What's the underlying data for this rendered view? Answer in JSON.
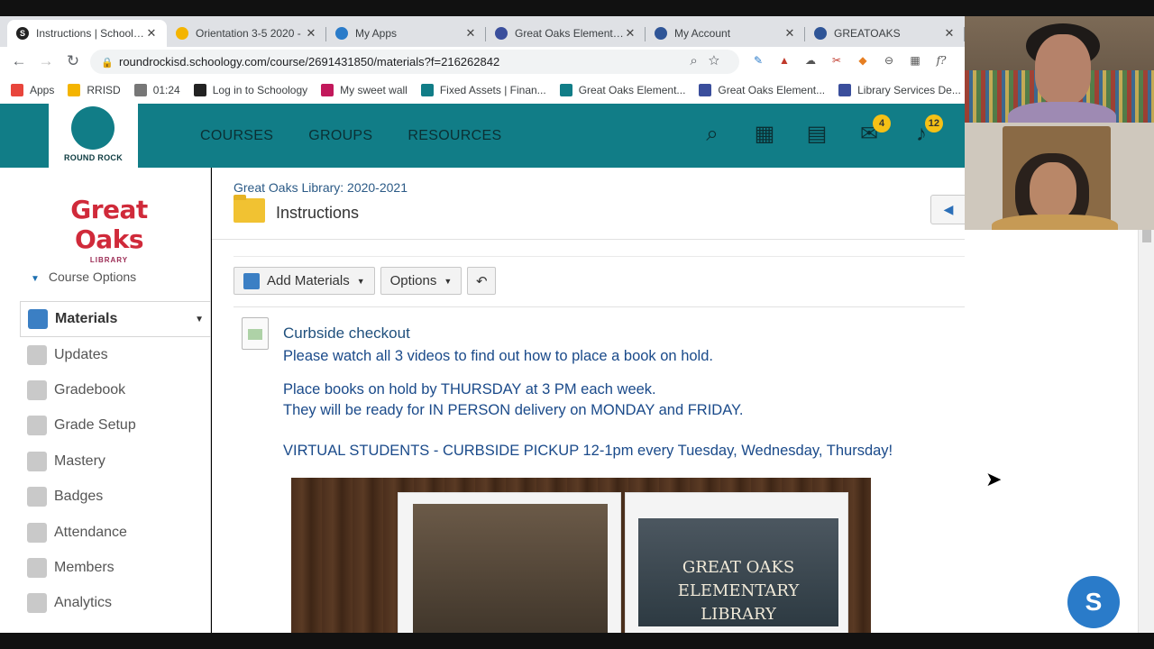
{
  "browser": {
    "tabs": [
      {
        "title": "Instructions | Schoology",
        "color": "#222222",
        "glyph": "S",
        "active": true
      },
      {
        "title": "Orientation 3-5 2020 -",
        "color": "#f4b400",
        "glyph": "",
        "active": false
      },
      {
        "title": "My Apps",
        "color": "#2a7bc9",
        "glyph": "",
        "active": false
      },
      {
        "title": "Great Oaks Elementary",
        "color": "#3a4e9c",
        "glyph": "",
        "active": false
      },
      {
        "title": "My Account",
        "color": "#2f5597",
        "glyph": "",
        "active": false
      },
      {
        "title": "GREATOAKS",
        "color": "#2f5597",
        "glyph": "",
        "active": false
      }
    ],
    "close_glyph": "✕",
    "url": "roundrockisd.schoology.com/course/2691431850/materials?f=216262842",
    "bookmarks": [
      {
        "label": "Apps",
        "color": "#e8453c"
      },
      {
        "label": "RRISD",
        "color": "#f4b400"
      },
      {
        "label": "01:24",
        "color": "#777777"
      },
      {
        "label": "Log in to Schoology",
        "color": "#222222"
      },
      {
        "label": "My sweet wall",
        "color": "#c2185b"
      },
      {
        "label": "Fixed Assets | Finan...",
        "color": "#117d87"
      },
      {
        "label": "Great Oaks Element...",
        "color": "#117d87"
      },
      {
        "label": "Great Oaks Element...",
        "color": "#3a4e9c"
      },
      {
        "label": "Library Services De...",
        "color": "#3a4e9c"
      }
    ]
  },
  "header": {
    "logo_text": "ROUND ROCK",
    "nav": [
      "COURSES",
      "GROUPS",
      "RESOURCES"
    ],
    "mail_badge": "4",
    "notif_badge": "12"
  },
  "sidebar": {
    "course_logo": "Great Oaks",
    "course_logo_sub": "LIBRARY",
    "course_options": "Course Options",
    "items": [
      {
        "label": "Materials",
        "active": true
      },
      {
        "label": "Updates"
      },
      {
        "label": "Gradebook"
      },
      {
        "label": "Grade Setup"
      },
      {
        "label": "Mastery"
      },
      {
        "label": "Badges"
      },
      {
        "label": "Attendance"
      },
      {
        "label": "Members"
      },
      {
        "label": "Analytics"
      }
    ]
  },
  "main": {
    "breadcrumb": "Great Oaks Library: 2020-2021",
    "title": "Instructions",
    "toolbar": {
      "add": "Add Materials",
      "options": "Options"
    },
    "item": {
      "title": "Curbside checkout",
      "lines": [
        "Please watch all 3 videos to find out how to place a book on hold.",
        "Place books on hold by THURSDAY at 3 PM each week.",
        "They will be ready for IN PERSON delivery on MONDAY and FRIDAY.",
        "VIRTUAL STUDENTS - CURBSIDE PICKUP 12-1pm every Tuesday, Wednesday, Thursday!"
      ]
    },
    "video_title": "GREAT OAKS ELEMENTARY LIBRARY"
  },
  "chat_bubble": "S"
}
